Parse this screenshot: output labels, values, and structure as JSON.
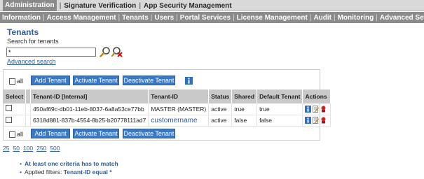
{
  "top_nav": {
    "items": [
      "Administration",
      "Signature Verification",
      "App Security Management"
    ],
    "active_index": 0
  },
  "sub_nav": {
    "items": [
      "Information",
      "Access Management",
      "Tenants",
      "Users",
      "Portal Services",
      "License Management",
      "Audit",
      "Monitoring",
      "Advanced Settings"
    ],
    "active_index": 2
  },
  "page": {
    "title": "Tenants",
    "subtitle": "Search for tenants",
    "search_value": "*",
    "advanced_link": "Advanced search"
  },
  "toolbar": {
    "all_label": "all",
    "add_label": "Add Tenant",
    "activate_label": "Activate Tenant",
    "deactivate_label": "Deactivate Tenant"
  },
  "table": {
    "headers": [
      "Select",
      "",
      "Tenant-ID [Internal]",
      "Tenant-ID",
      "Status",
      "Shared",
      "Default Tenant",
      "Actions"
    ],
    "rows": [
      {
        "internal_id": "450af69c-db01-11eb-8037-6a8a53ce77bb",
        "tenant_id": "MASTER (MASTER)",
        "status": "active",
        "shared": "true",
        "default": "true"
      },
      {
        "internal_id": "6318d881-837b-4554-8b25-b20778111ad7",
        "tenant_id": "customername",
        "status": "active",
        "shared": "false",
        "default": "false"
      }
    ]
  },
  "pager": [
    "25",
    "50",
    "100",
    "250",
    "500"
  ],
  "notes": {
    "criteria": "At least one criteria has to match",
    "filters_label": "Applied filters:",
    "filters_value": "Tenant-ID equal *"
  },
  "colors": {
    "accent": "#2f5d9a",
    "button": "#3a78c3",
    "nav_active": "#8a8a8a"
  }
}
